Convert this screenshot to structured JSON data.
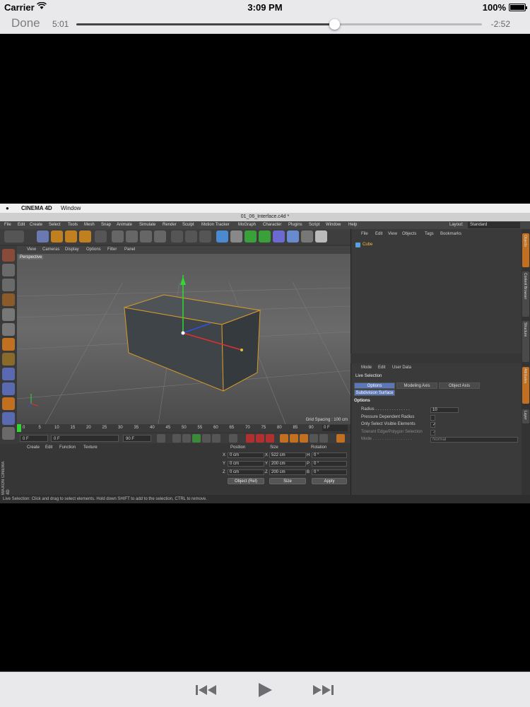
{
  "status_bar": {
    "carrier": "Carrier",
    "time": "3:09 PM",
    "battery": "100%",
    "battery_level": 1.0
  },
  "player": {
    "done_label": "Done",
    "elapsed": "5:01",
    "remaining": "-2:52",
    "progress": 0.636
  },
  "app": {
    "mac_menu": {
      "app_name": "CINEMA 4D",
      "window": "Window"
    },
    "window_title": "01_06_Interface.c4d *",
    "main_menu": [
      "File",
      "Edit",
      "Create",
      "Select",
      "Tools",
      "Mesh",
      "Snap",
      "Animate",
      "Simulate",
      "Render",
      "Sculpt",
      "Motion Tracker",
      "MoGraph",
      "Character",
      "Plugins",
      "Script",
      "Window",
      "Help"
    ],
    "layout_label": "Layout:",
    "layout_value": "Standard",
    "viewport_menu": [
      "View",
      "Cameras",
      "Display",
      "Options",
      "Filter",
      "Panel"
    ],
    "viewport_label": "Perspective",
    "grid_spacing": "Grid Spacing : 100 cm",
    "timeline_ticks": [
      "0",
      "5",
      "10",
      "15",
      "20",
      "25",
      "30",
      "35",
      "40",
      "45",
      "50",
      "55",
      "60",
      "65",
      "70",
      "75",
      "80",
      "85",
      "90"
    ],
    "timeline_end": "0 F",
    "transport": {
      "start": "0 F",
      "current": "0 F",
      "min": "90 F",
      "max": "90 F"
    },
    "material_menu": [
      "Create",
      "Edit",
      "Function",
      "Texture"
    ],
    "brand": "MAXON CINEMA 4D",
    "coords": {
      "headers": [
        "Position",
        "Size",
        "Rotation"
      ],
      "rows": [
        {
          "axis": "X",
          "pos": "0 cm",
          "size_axis": "X",
          "size": "522 cm",
          "rot_axis": "H",
          "rot": "0 °"
        },
        {
          "axis": "Y",
          "pos": "0 cm",
          "size_axis": "Y",
          "size": "200 cm",
          "rot_axis": "P",
          "rot": "0 °"
        },
        {
          "axis": "Z",
          "pos": "0 cm",
          "size_axis": "Z",
          "size": "200 cm",
          "rot_axis": "B",
          "rot": "0 °"
        }
      ],
      "mode_select": "Object (Rel)",
      "size_select": "Size",
      "apply": "Apply"
    },
    "object_manager": {
      "menu": [
        "File",
        "Edit",
        "View",
        "Objects",
        "Tags",
        "Bookmarks"
      ],
      "object_name": "Cube"
    },
    "attributes": {
      "menu": [
        "Mode",
        "Edit",
        "User Data"
      ],
      "tool_name": "Live Selection",
      "tabs": [
        "Options",
        "Modeling Axis",
        "Object Axis"
      ],
      "subtab": "Subdivision Surface",
      "section": "Options",
      "fields": [
        {
          "label": "Radius . . . . . . . . . . . . . . .",
          "value": "10"
        },
        {
          "label": "Pressure Dependent Radius",
          "value": ""
        },
        {
          "label": "Only Select Visible Elements",
          "value": "✓"
        },
        {
          "label": "Tolerant Edge/Polygon Selection",
          "value": "✓"
        },
        {
          "label": "Mode . . . . . . . . . . . . . . . . .",
          "value": "Normal"
        }
      ]
    },
    "right_tabs": [
      "Objects",
      "Content Browser",
      "Structure",
      "Attributes",
      "Layer"
    ],
    "status_line": "Live Selection: Click and drag to select elements. Hold down SHIFT to add to the selection, CTRL to remove."
  },
  "colors": {
    "accent": "#ffb833",
    "panel": "#3a3a3a",
    "viewport": "#5e5e5e",
    "ios_bar": "#e9e9ec"
  }
}
